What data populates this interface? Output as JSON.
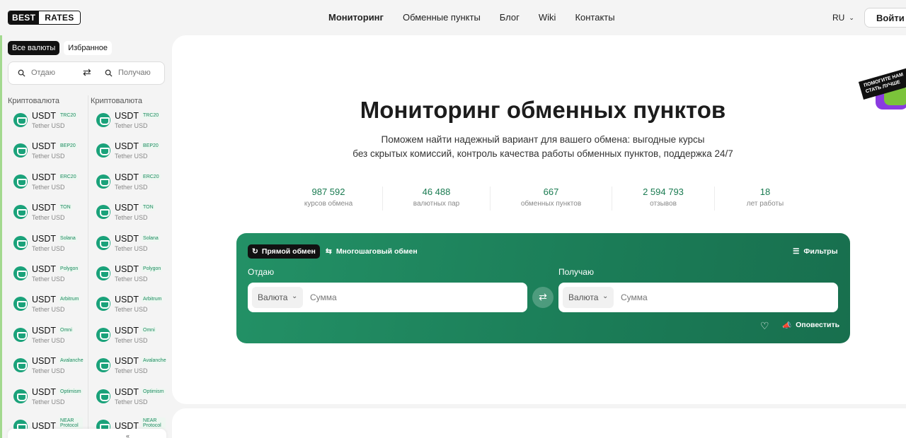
{
  "header": {
    "logo_part1": "BEST",
    "logo_part2": "RATES",
    "nav": [
      "Мониторинг",
      "Обменные пункты",
      "Блог",
      "Wiki",
      "Контакты"
    ],
    "lang": "RU",
    "login": "Войти"
  },
  "sidebar": {
    "tab_all": "Все валюты",
    "tab_fav": "Избранное",
    "search_give": "Отдаю",
    "search_get": "Получаю",
    "col_left": "Криптовалюта",
    "col_right": "Криптовалюта",
    "items": [
      {
        "code": "USDT",
        "net": "TRC20",
        "name": "Tether USD"
      },
      {
        "code": "USDT",
        "net": "BEP20",
        "name": "Tether USD"
      },
      {
        "code": "USDT",
        "net": "ERC20",
        "name": "Tether USD"
      },
      {
        "code": "USDT",
        "net": "TON",
        "name": "Tether USD"
      },
      {
        "code": "USDT",
        "net": "Solana",
        "name": "Tether USD"
      },
      {
        "code": "USDT",
        "net": "Polygon",
        "name": "Tether USD"
      },
      {
        "code": "USDT",
        "net": "Arbitrum",
        "name": "Tether USD"
      },
      {
        "code": "USDT",
        "net": "Omni",
        "name": "Tether USD"
      },
      {
        "code": "USDT",
        "net": "Avalanche",
        "name": "Tether USD"
      },
      {
        "code": "USDT",
        "net": "Optimism",
        "name": "Tether USD"
      },
      {
        "code": "USDT",
        "net": "NEAR Protocol",
        "name": ""
      }
    ]
  },
  "main": {
    "sticker_text": "ПОМОГИТЕ НАМ СТАТЬ ЛУЧШЕ",
    "title": "Мониторинг обменных пунктов",
    "subtitle_line1": "Поможем найти надежный вариант для вашего обмена: выгодные курсы",
    "subtitle_line2": "без скрытых комиссий, контроль качества работы обменных пунктов, поддержка 24/7",
    "stats": [
      {
        "value": "987 592",
        "label": "курсов обмена"
      },
      {
        "value": "46 488",
        "label": "валютных пар"
      },
      {
        "value": "667",
        "label": "обменных пунктов"
      },
      {
        "value": "2 594 793",
        "label": "отзывов"
      },
      {
        "value": "18",
        "label": "лет работы"
      }
    ]
  },
  "exchange": {
    "mode_direct": "Прямой обмен",
    "mode_multi": "Многошаговый обмен",
    "filters": "Фильтры",
    "give_label": "Отдаю",
    "get_label": "Получаю",
    "currency_placeholder": "Валюта",
    "amount_placeholder": "Сумма",
    "notify": "Оповестить"
  },
  "colors": {
    "accent_green": "#1a7b51",
    "card_green": "#1f8a5f",
    "coin_teal": "#1aa27a"
  }
}
